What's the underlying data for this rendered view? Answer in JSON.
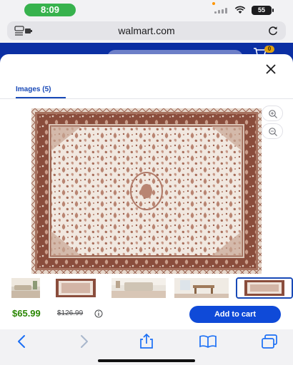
{
  "status_bar": {
    "time": "8:09",
    "battery": "55"
  },
  "address_bar": {
    "url": "walmart.com"
  },
  "walmart_header": {
    "cart_count": "0"
  },
  "modal": {
    "tab_label": "Images (5)",
    "image_count": 5,
    "selected_thumbnail_index": 4,
    "thumbnails": [
      "living-room-scene",
      "rug-front-view",
      "bedroom-scene",
      "dining-room-scene",
      "rug-front-view"
    ],
    "main_image": "rug-product-photo"
  },
  "purchase": {
    "price_now": "$65.99",
    "price_was": "$126.99",
    "add_to_cart_label": "Add to cart"
  },
  "colors": {
    "walmart_blue": "#0b2fa3",
    "button_blue": "#0f4ad8",
    "price_green": "#2a8703",
    "rug_rust": "#8a4d3c",
    "rug_cream": "#f1e8e0",
    "time_pill_green": "#37b24d"
  },
  "icons": {
    "safari_back": "chevron-left-icon",
    "safari_forward": "chevron-right-icon",
    "share": "share-icon",
    "bookmarks": "book-icon",
    "tabs": "tabs-icon"
  }
}
